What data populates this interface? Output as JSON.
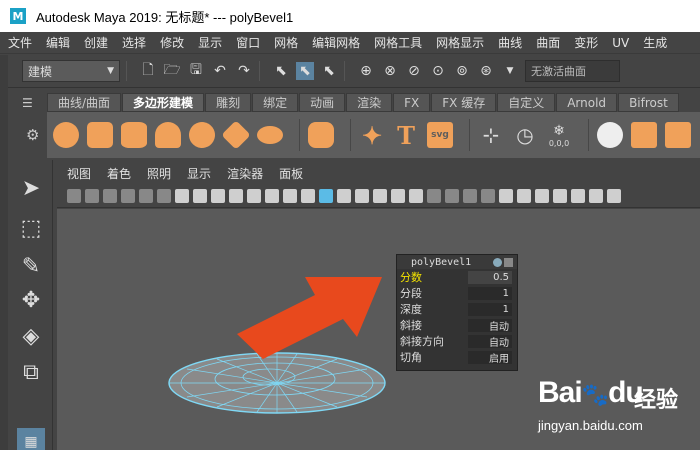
{
  "window": {
    "title": "Autodesk Maya 2019: 无标题*   ---   polyBevel1",
    "logo_letter": "M"
  },
  "menubar": [
    "文件",
    "编辑",
    "创建",
    "选择",
    "修改",
    "显示",
    "窗口",
    "网格",
    "编辑网格",
    "网格工具",
    "网格显示",
    "曲线",
    "曲面",
    "变形",
    "UV",
    "生成"
  ],
  "statusline": {
    "mode": "建模",
    "live_surface": "无激活曲面"
  },
  "shelf": {
    "tabs": [
      "曲线/曲面",
      "多边形建模",
      "雕刻",
      "绑定",
      "动画",
      "渲染",
      "FX",
      "FX 缓存",
      "自定义",
      "Arnold",
      "Bifrost"
    ],
    "active_tab": "多边形建模",
    "text_icon": "T",
    "svg_icon": "svg",
    "count_icon": "0,0,0"
  },
  "panel": {
    "menu": [
      "视图",
      "着色",
      "照明",
      "显示",
      "渲染器",
      "面板"
    ]
  },
  "inview_editor": {
    "title": "polyBevel1",
    "rows": [
      {
        "label": "分数",
        "value": "0.5",
        "highlight": true
      },
      {
        "label": "分段",
        "value": "1",
        "highlight": false
      },
      {
        "label": "深度",
        "value": "1",
        "highlight": false
      },
      {
        "label": "斜接",
        "value": "自动",
        "highlight": false
      },
      {
        "label": "斜接方向",
        "value": "自动",
        "highlight": false
      },
      {
        "label": "切角",
        "value": "启用",
        "highlight": false
      }
    ]
  },
  "watermark": {
    "brand": "Bai",
    "brand2": "du",
    "cn": "经验",
    "url": "jingyan.baidu.com"
  },
  "colors": {
    "accent": "#5bbbe6",
    "shelf_icon": "#f0a15a",
    "arrow": "#e8491d",
    "mesh": "#7fd8f5",
    "highlight_label": "#f5e400"
  }
}
